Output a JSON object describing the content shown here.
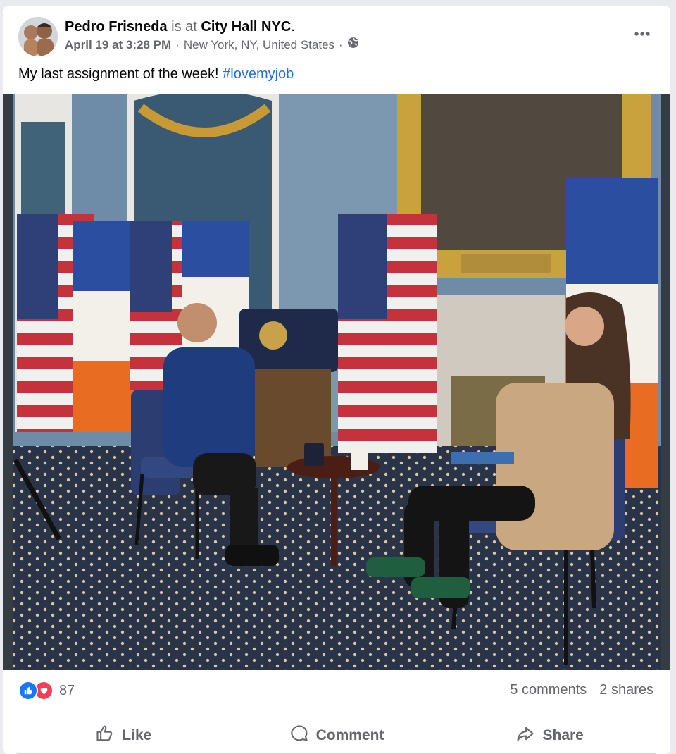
{
  "post": {
    "author": "Pedro Frisneda",
    "is_at": "is at",
    "place": "City Hall NYC",
    "period": ".",
    "date": "April 19 at 3:28 PM",
    "separator": "·",
    "location": "New York, NY, United States",
    "caption_text": "My last assignment of the week! ",
    "hashtag": "#lovemyjob"
  },
  "stats": {
    "reaction_count": "87",
    "comments": "5 comments",
    "shares": "2 shares"
  },
  "actions": {
    "like": "Like",
    "comment": "Comment",
    "share": "Share"
  },
  "colors": {
    "link_blue": "#216fdb",
    "like_blue": "#1877f2",
    "love_red": "#f33e58",
    "muted_text": "#65676b"
  },
  "icons": [
    "more-options-icon",
    "globe-icon",
    "like-reaction-icon",
    "love-reaction-icon",
    "thumbs-up-icon",
    "comment-bubble-icon",
    "share-arrow-icon"
  ]
}
